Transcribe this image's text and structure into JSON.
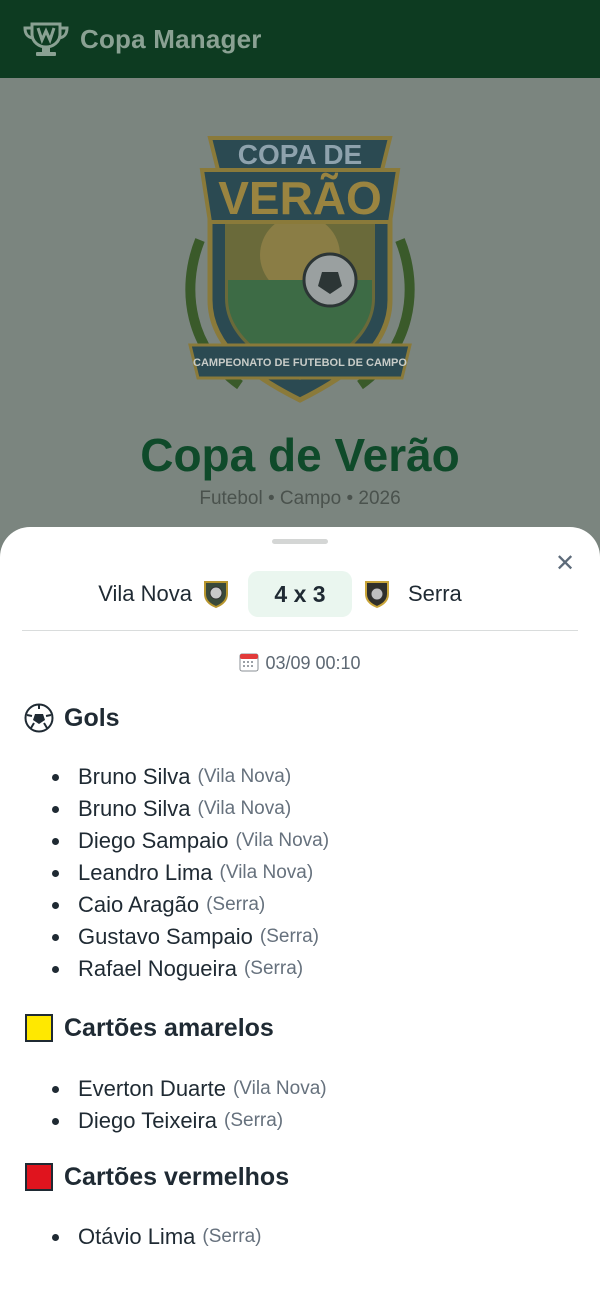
{
  "app": {
    "title": "Copa Manager"
  },
  "tournament": {
    "name": "Copa de Verão",
    "subtitle": "Futebol • Campo • 2026",
    "crest_top_text": "COPA DE",
    "crest_main_text": "VERÃO",
    "crest_ribbon_text": "CAMPEONATO DE FUTEBOL DE CAMPO"
  },
  "match": {
    "home_team": "Vila Nova",
    "away_team": "Serra",
    "score": "4 x 3",
    "datetime": "03/09 00:10"
  },
  "sections": {
    "goals": {
      "title": "Gols",
      "icon": "soccer-ball-icon",
      "items": [
        {
          "player": "Bruno Silva",
          "team": "(Vila Nova)"
        },
        {
          "player": "Bruno Silva",
          "team": "(Vila Nova)"
        },
        {
          "player": "Diego Sampaio",
          "team": "(Vila Nova)"
        },
        {
          "player": "Leandro Lima",
          "team": "(Vila Nova)"
        },
        {
          "player": "Caio Aragão",
          "team": "(Serra)"
        },
        {
          "player": "Gustavo Sampaio",
          "team": "(Serra)"
        },
        {
          "player": "Rafael Nogueira",
          "team": "(Serra)"
        }
      ]
    },
    "yellow_cards": {
      "title": "Cartões amarelos",
      "icon": "yellow-card-icon",
      "color": "#ffe800",
      "items": [
        {
          "player": "Everton Duarte",
          "team": "(Vila Nova)"
        },
        {
          "player": "Diego Teixeira",
          "team": "(Serra)"
        }
      ]
    },
    "red_cards": {
      "title": "Cartões vermelhos",
      "icon": "red-card-icon",
      "color": "#e0141e",
      "items": [
        {
          "player": "Otávio Lima",
          "team": "(Serra)"
        }
      ]
    }
  },
  "colors": {
    "header_bg": "#0d3b21",
    "title_green": "#0f4a2a",
    "score_bg": "#eaf6ef"
  }
}
